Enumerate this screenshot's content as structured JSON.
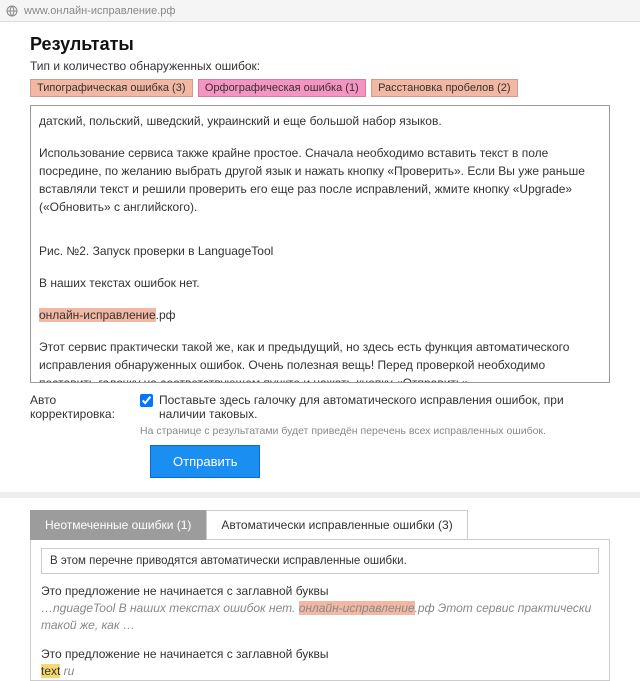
{
  "url": "www.онлайн-исправление.рф",
  "heading": "Результаты",
  "subtitle": "Тип и количество обнаруженных ошибок:",
  "badges": [
    {
      "label": "Типографическая ошибка (3)"
    },
    {
      "label": "Орфографическая ошибка (1)"
    },
    {
      "label": "Расстановка пробелов (2)"
    }
  ],
  "textarea": {
    "line1": "датский, польский, шведский, украинский и еще большой набор языков.",
    "line2": "Использование сервиса также крайне простое. Сначала необходимо вставить текст в поле посредине, по желанию выбрать другой язык и нажать кнопку «Проверить». Если Вы уже раньше вставляли текст и решили проверить его еще раз после исправлений, жмите кнопку «Upgrade» («Обновить» с английского).",
    "line3": "Рис. №2. Запуск проверки в LanguageTool",
    "line4": "В наших текстах ошибок нет.",
    "hl": "онлайн-исправление",
    "hl_after": ".рф",
    "line6": "Этот сервис практически такой же, как и предыдущий, но здесь есть функция автоматического исправления обнаруженных ошибок. Очень полезная вещь! Перед проверкой необходимо поставить галочку на соответствующем пункте и нажать кнопку «Отправить»."
  },
  "autocorrect": {
    "label": "Авто корректировка:",
    "cb_text": "Поставьте здесь галочку для автоматического исправления ошибок, при наличии таковых.",
    "hint": "На странице с результатами будет приведён перечень всех исправленных ошибок."
  },
  "submit_btn": "Отправить",
  "tabs": {
    "t0": "Неотмеченные ошибки (1)",
    "t1": "Автоматически исправленные ошибки (3)"
  },
  "panel": {
    "intro": "В этом перечне приводятся автоматически исправленные ошибки.",
    "err1_title": "Это предложение не начинается с заглавной буквы",
    "err1_pre": "…nguageTool В наших текстах ошибок нет. ",
    "err1_hl": "онлайн-исправление",
    "err1_post": ".рф Этот сервис практически такой же, как …",
    "err2_title": "Это предложение не начинается с заглавной буквы",
    "err2_pre": "",
    "err2_hl": "text",
    "err2_post": " ru"
  }
}
